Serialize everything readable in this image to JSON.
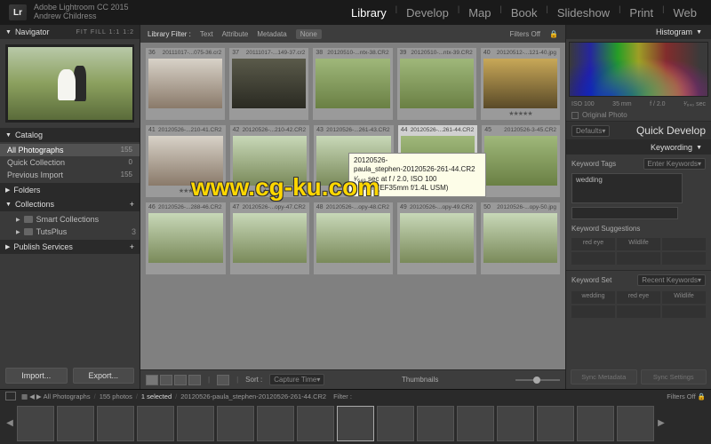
{
  "app": {
    "name": "Adobe Lightroom CC 2015",
    "user": "Andrew Childress",
    "logo": "Lr"
  },
  "modules": [
    "Library",
    "Develop",
    "Map",
    "Book",
    "Slideshow",
    "Print",
    "Web"
  ],
  "active_module": "Library",
  "navigator": {
    "label": "Navigator",
    "controls": "FIT  FILL  1:1  1:2"
  },
  "catalog": {
    "label": "Catalog",
    "items": [
      {
        "name": "All Photographs",
        "count": "155",
        "selected": true
      },
      {
        "name": "Quick Collection",
        "count": "0"
      },
      {
        "name": "Previous Import",
        "count": "155"
      }
    ]
  },
  "folders_label": "Folders",
  "collections": {
    "label": "Collections",
    "items": [
      {
        "name": "Smart Collections"
      },
      {
        "name": "TutsPlus"
      }
    ]
  },
  "publish_label": "Publish Services",
  "left_buttons": {
    "import": "Import...",
    "export": "Export..."
  },
  "filter_bar": {
    "label": "Library Filter :",
    "opts": [
      "Text",
      "Attribute",
      "Metadata",
      "None"
    ],
    "active": "None",
    "filters_off": "Filters Off"
  },
  "grid": {
    "row1": [
      {
        "idx": "36",
        "name": "20111017-...075-36.cr2",
        "cls": "t-portrait"
      },
      {
        "idx": "37",
        "name": "20111017-...149-37.cr2",
        "cls": "t-dark"
      },
      {
        "idx": "38",
        "name": "20120510-...ntx-38.CR2",
        "cls": "t-green"
      },
      {
        "idx": "39",
        "name": "20120510-...ntx-39.CR2",
        "cls": "t-green"
      },
      {
        "idx": "40",
        "name": "20120512-...121-40.jpg",
        "cls": "t-gold",
        "stars": "★★★★★"
      }
    ],
    "row2": [
      {
        "idx": "41",
        "name": "20120526-...210-41.CR2",
        "cls": "t-portrait",
        "stars": "★★★"
      },
      {
        "idx": "42",
        "name": "20120526-...210-42.CR2",
        "cls": "t-couple",
        "stars": "★★★"
      },
      {
        "idx": "43",
        "name": "20120526-...261-43.CR2",
        "cls": "t-couple",
        "stars": "★★★"
      },
      {
        "idx": "44",
        "name": "20120526-...261-44.CR2",
        "cls": "t-green",
        "selected": true
      },
      {
        "idx": "45",
        "name": "20120526-3-45.CR2",
        "cls": "t-green"
      }
    ],
    "row3": [
      {
        "idx": "46",
        "name": "20120526-...288-46.CR2",
        "cls": "t-couple"
      },
      {
        "idx": "47",
        "name": "20120526-...opy-47.CR2",
        "cls": "t-couple"
      },
      {
        "idx": "48",
        "name": "20120526-...opy-48.CR2",
        "cls": "t-couple"
      },
      {
        "idx": "49",
        "name": "20120526-...opy-49.CR2",
        "cls": "t-couple"
      },
      {
        "idx": "50",
        "name": "20120526-...opy-50.jpg",
        "cls": "t-couple"
      }
    ]
  },
  "tooltip": {
    "l1": "20120526-",
    "l2": "paula_stephen-20120526-261-44.CR2",
    "l3": "¹⁄₆₄₀ sec at f / 2.0, ISO 100",
    "l4": "35 mm (EF35mm f/1.4L USM)"
  },
  "watermark": "www.cg-ku.com",
  "center_toolbar": {
    "sort_label": "Sort :",
    "sort_value": "Capture Time",
    "thumb_label": "Thumbnails"
  },
  "histogram_label": "Histogram",
  "histo_info": {
    "iso": "ISO 100",
    "focal": "35 mm",
    "ap": "f / 2.0",
    "sh": "¹⁄₆₄₀ sec"
  },
  "orig_photo": "Original Photo",
  "quick_develop": {
    "defaults": "Defaults",
    "label": "Quick Develop"
  },
  "keywording": {
    "label": "Keywording",
    "tags_label": "Keyword Tags",
    "enter": "Enter Keywords",
    "value": "wedding",
    "suggestions_label": "Keyword Suggestions",
    "suggestions": [
      "red eye",
      "Wildlife",
      ""
    ],
    "set_label": "Keyword Set",
    "set_value": "Recent Keywords",
    "set_items": [
      "wedding",
      "red eye",
      "Wildlife"
    ]
  },
  "right_buttons": {
    "sync_meta": "Sync Metadata",
    "sync_settings": "Sync Settings"
  },
  "filmstrip": {
    "source": "All Photographs",
    "count": "155 photos",
    "selected": "1 selected",
    "file": "20120526-paula_stephen-20120526-261-44.CR2",
    "filter_label": "Filter :",
    "filters_off": "Filters Off"
  }
}
